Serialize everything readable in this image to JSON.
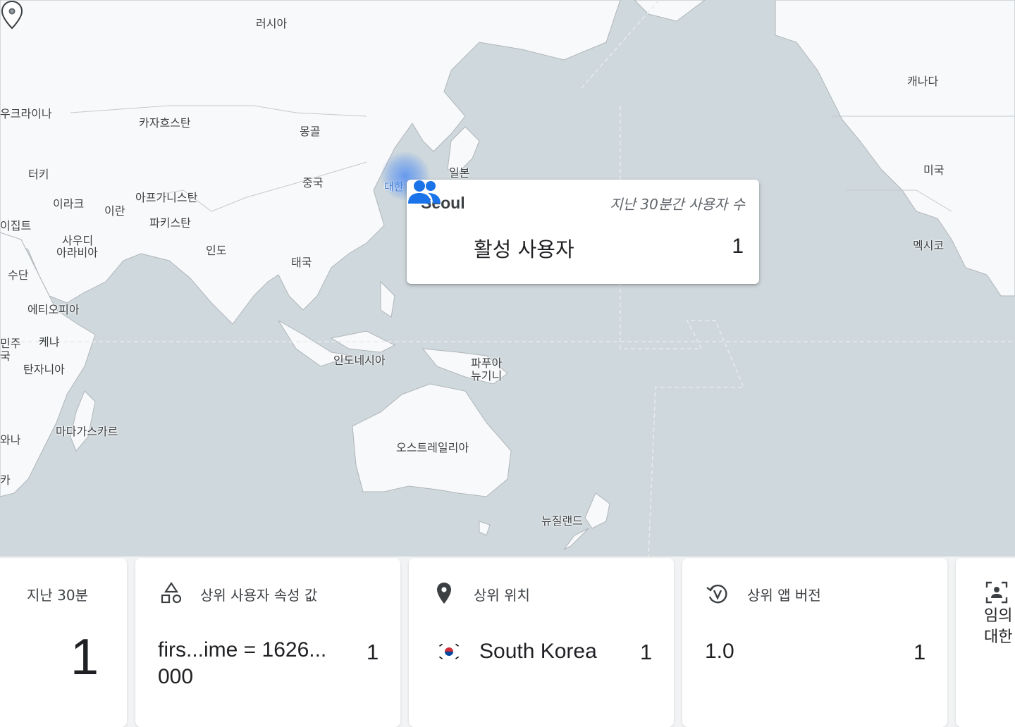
{
  "map": {
    "labels": {
      "russia": "러시아",
      "ukraine": "우크라이나",
      "kazakhstan": "카자흐스탄",
      "mongolia": "몽골",
      "turkey": "터키",
      "iraq": "이라크",
      "iran": "이란",
      "afghanistan": "아프가니스탄",
      "pakistan": "파키스탄",
      "china": "중국",
      "japan": "일본",
      "korea_partial": "대한",
      "egypt": "이집트",
      "saudi_1": "사우디",
      "saudi_2": "아라비아",
      "india": "인도",
      "thailand": "태국",
      "sudan": "수단",
      "ethiopia": "에티오피아",
      "kenya": "케냐",
      "tanzania": "탄자니아",
      "indonesia": "인도네시아",
      "png_1": "파푸아",
      "png_2": "뉴기니",
      "madagascar": "마다가스카르",
      "australia": "오스트레일리아",
      "new_zealand": "뉴질랜드",
      "canada": "캐나다",
      "usa": "미국",
      "mexico": "멕시코",
      "left_edge_1": "민주",
      "left_edge_2": "국",
      "left_edge_3": "와나",
      "left_edge_4": "카"
    }
  },
  "tooltip": {
    "city": "Seoul",
    "subtitle": "지난 30분간 사용자 수",
    "metric_label": "활성 사용자",
    "metric_value": "1",
    "icon": "people-icon",
    "accent": "#1a73e8"
  },
  "cards": {
    "last30": {
      "title": "지난 30분",
      "value": "1"
    },
    "user_property": {
      "title": "상위 사용자 속성 값",
      "icon": "category-shapes-icon",
      "row_label": "firs...ime = 1626...\n000",
      "row_value": "1"
    },
    "location": {
      "title": "상위 위치",
      "icon": "location-pin-icon",
      "row_label": "South Korea",
      "row_value": "1"
    },
    "app_version": {
      "title": "상위 앱 버전",
      "icon": "version-history-icon",
      "row_label": "1.0",
      "row_value": "1"
    },
    "partial": {
      "icon": "person-frame-icon",
      "line1": "임의",
      "line2": "대한"
    }
  }
}
